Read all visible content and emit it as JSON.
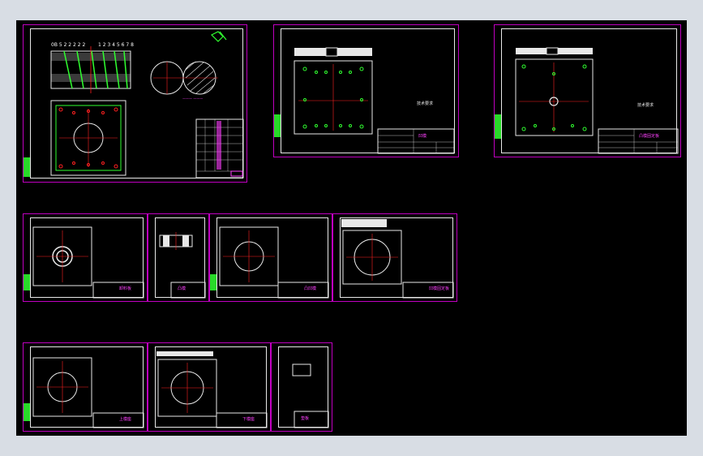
{
  "window": {
    "background": "#d8dde4",
    "canvas_background": "#000000"
  },
  "colors": {
    "frame": "#c000c0",
    "border": "#e8e8e8",
    "centerline": "#ff2020",
    "geometry": "#30ff30",
    "text": "#ff40ff"
  },
  "sheets": {
    "s1": {
      "dim_text": "0B 5 2 2 2 2 2",
      "dim_text2": "1 2 3 4 5 6 7 8",
      "label": "装配图"
    },
    "s2": {
      "note": "技术要求",
      "title": "凹模"
    },
    "s3": {
      "note": "技术要求",
      "title": "凸模固定板"
    },
    "s4": {
      "title": "卸料板"
    },
    "s5": {
      "title": "凸模"
    },
    "s6": {
      "title": "凸凹模"
    },
    "s7": {
      "title": "凹模固定板"
    },
    "s8": {
      "title": "上模座"
    },
    "s9": {
      "title": "下模座"
    },
    "s10": {
      "title": "垫板"
    }
  }
}
